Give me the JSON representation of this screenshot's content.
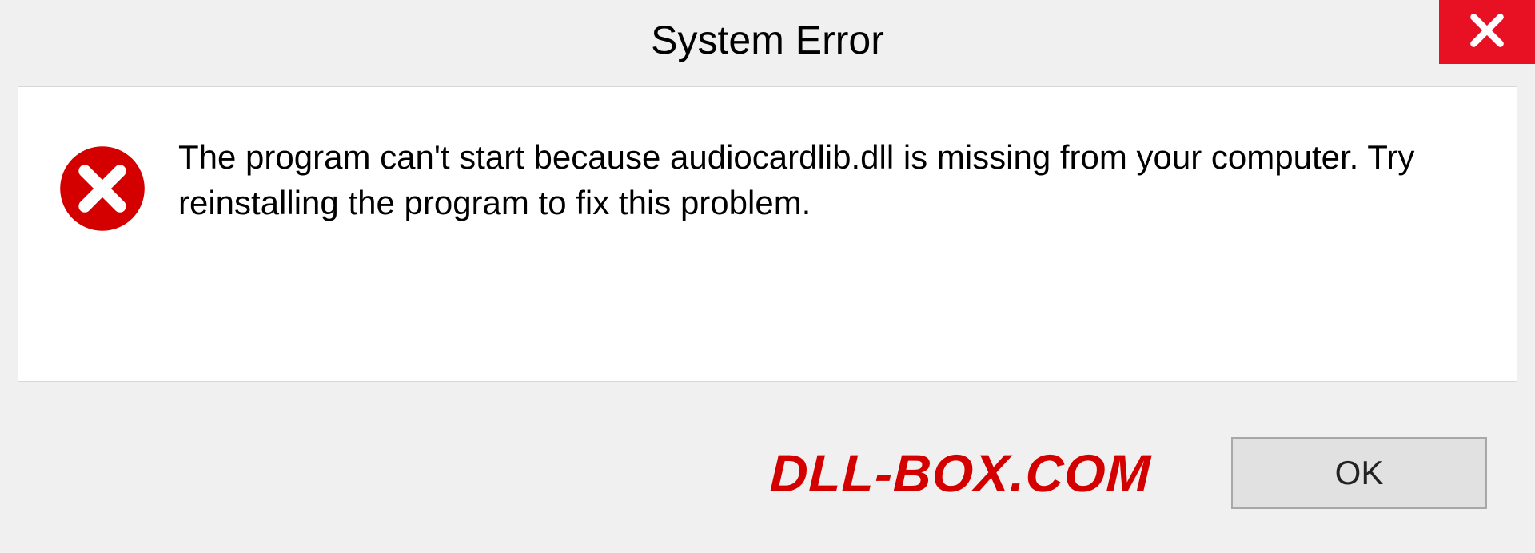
{
  "titlebar": {
    "title": "System Error"
  },
  "dialog": {
    "message": "The program can't start because audiocardlib.dll is missing from your computer. Try reinstalling the program to fix this problem."
  },
  "footer": {
    "watermark": "DLL-BOX.COM",
    "ok_label": "OK"
  },
  "colors": {
    "close_bg": "#e81123",
    "error_icon": "#d40000",
    "watermark": "#d40000"
  }
}
